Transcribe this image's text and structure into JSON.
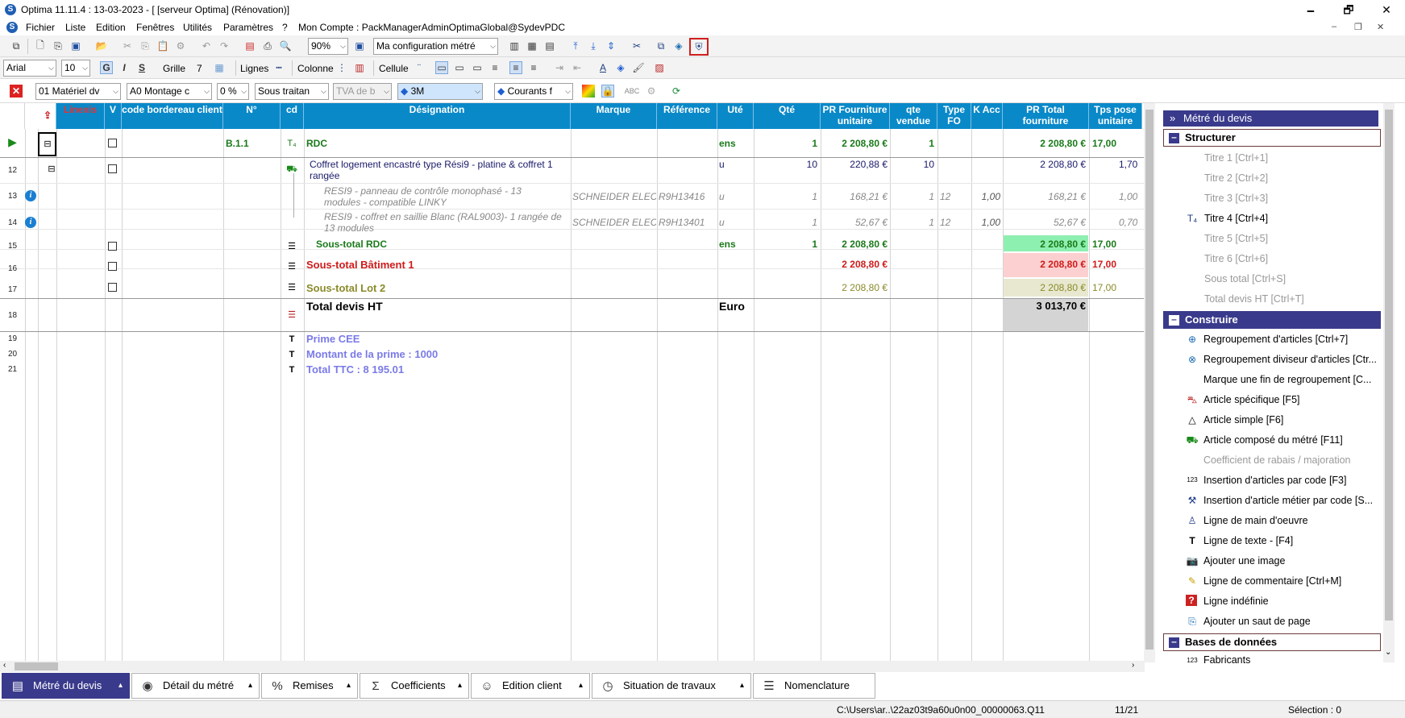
{
  "window": {
    "title": "Optima 11.11.4 : 13-03-2023 - [ [serveur Optima] (Rénovation)]",
    "app_icon": "optima-logo-icon",
    "minimize": "🗕",
    "maximize": "🗗",
    "close": "✕"
  },
  "menu": [
    "Fichier",
    "Liste",
    "Edition",
    "Fenêtres",
    "Utilités",
    "Paramètres",
    "?",
    "Mon Compte : PackManagerAdminOptimaGlobal@SydevPDC"
  ],
  "toolbar1": {
    "zoom": "90%",
    "config": "Ma configuration métré"
  },
  "toolbar2": {
    "font": "Arial",
    "size": "10",
    "bold": "G",
    "italic": "I",
    "strike": "S",
    "grille": "Grille",
    "grille_val": "7",
    "lignes": "Lignes",
    "colonne": "Colonne",
    "cellule": "Cellule"
  },
  "toolbar3": {
    "materiel": "01  Matériel dv",
    "montage": "A0  Montage c",
    "pct": "0 %",
    "sous": "Sous traitan",
    "tva": "TVA de b",
    "marque": "3M",
    "courants": "Courants f"
  },
  "columns": [
    "Linexis",
    "V",
    "code bordereau client",
    "N°",
    "cd",
    "Désignation",
    "Marque",
    "Référence",
    "Uté",
    "Qté",
    "PR Fourniture unitaire",
    "qte vendue",
    "Type FO",
    "K Acc",
    "PR Total fourniture",
    "Tps pose unitaire"
  ],
  "rows": {
    "r0": {
      "num": "B.1.1",
      "des": "RDC",
      "ute": "ens",
      "qte": "1",
      "pru": "2 208,80 €",
      "qv": "1",
      "prt": "2 208,80 €",
      "tps": "17,00"
    },
    "r12": {
      "rn": "12",
      "des1": "Coffret logement encastré type Rési9 - platine & coffret 1",
      "des2": "rangée",
      "ute": "u",
      "qte": "10",
      "pru": "220,88 €",
      "qv": "10",
      "prt": "2 208,80 €",
      "tps": "1,70"
    },
    "r13": {
      "rn": "13",
      "des1": "RESI9 - panneau de contrôle monophasé - 13",
      "des2": "modules - compatible LINKY",
      "marque": "SCHNEIDER ELEC",
      "ref": "R9H13416",
      "ute": "u",
      "qte": "1",
      "pru": "168,21 €",
      "qv": "1",
      "type": "12",
      "kacc": "1,00",
      "prt": "168,21 €",
      "tps": "1,00"
    },
    "r14": {
      "rn": "14",
      "des1": "RESI9 - coffret en saillie Blanc (RAL9003)- 1 rangée de",
      "des2": "13 modules",
      "marque": "SCHNEIDER ELEC",
      "ref": "R9H13401",
      "ute": "u",
      "qte": "1",
      "pru": "52,67 €",
      "qv": "1",
      "type": "12",
      "kacc": "1,00",
      "prt": "52,67 €",
      "tps": "0,70"
    },
    "r15": {
      "rn": "15",
      "des": "Sous-total RDC",
      "ute": "ens",
      "qte": "1",
      "pru": "2 208,80 €",
      "prt": "2 208,80 €",
      "tps": "17,00"
    },
    "r16": {
      "rn": "16",
      "des": "Sous-total Bâtiment 1",
      "pru": "2 208,80 €",
      "prt": "2 208,80 €",
      "tps": "17,00"
    },
    "r17": {
      "rn": "17",
      "des": "Sous-total Lot 2",
      "pru": "2 208,80 €",
      "prt": "2 208,80 €",
      "tps": "17,00"
    },
    "r18": {
      "rn": "18",
      "des": "Total devis HT",
      "ute": "Euro",
      "prt": "3 013,70 €"
    },
    "r19": {
      "rn": "19",
      "des": "Prime CEE"
    },
    "r20": {
      "rn": "20",
      "des": "Montant  de la prime : 1000"
    },
    "r21": {
      "rn": "21",
      "des": "Total TTC : 8 195.01"
    }
  },
  "side": {
    "title": "Métré du devis",
    "structurer": "Structurer",
    "struct_items": [
      "Titre 1 [Ctrl+1]",
      "Titre 2 [Ctrl+2]",
      "Titre 3 [Ctrl+3]",
      "Titre 4 [Ctrl+4]",
      "Titre 5 [Ctrl+5]",
      "Titre 6 [Ctrl+6]",
      "Sous total [Ctrl+S]",
      "Total devis HT [Ctrl+T]"
    ],
    "construire": "Construire",
    "constr_items": [
      "Regroupement d'articles  [Ctrl+7]",
      "Regroupement diviseur d'articles [Ctr...",
      "Marque une fin de regroupement  [C...",
      "Article spécifique [F5]",
      "Article simple [F6]",
      "Article composé du métré [F11]",
      "Coefficient de rabais / majoration",
      "Insertion d'articles par code [F3]",
      "Insertion d'article métier par code [S...",
      "Ligne de main d'oeuvre",
      "Ligne de texte - [F4]",
      "Ajouter une image",
      "Ligne de commentaire [Ctrl+M]",
      "Ligne indéfinie",
      "Ajouter un saut de page"
    ],
    "bases": "Bases de données",
    "bases_items": [
      "Fabricants"
    ]
  },
  "tabs": [
    "Métré du devis",
    "Détail du métré",
    "Remises",
    "Coefficients",
    "Edition client",
    "Situation de travaux",
    "Nomenclature"
  ],
  "status": {
    "path": "C:\\Users\\ar..\\22az03t9a60u0n00_00000063.Q11",
    "pos": "11/21",
    "sel": "Sélection : 0"
  }
}
